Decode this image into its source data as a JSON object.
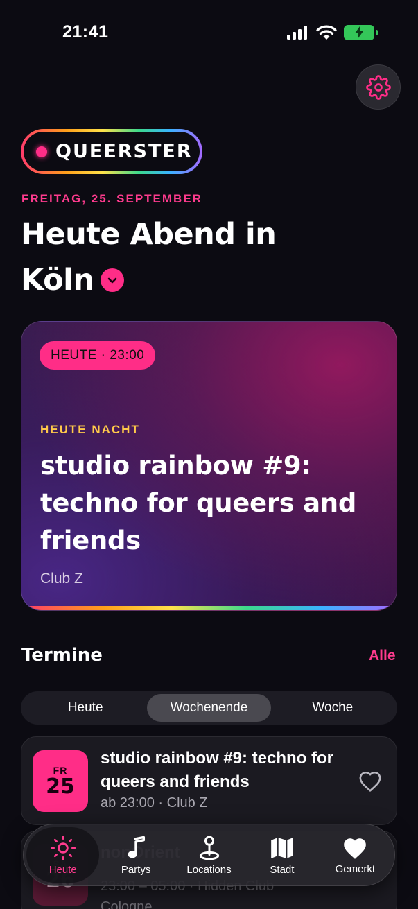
{
  "status_bar": {
    "time": "21:41"
  },
  "brand": {
    "logo_text": "QUEERSTER"
  },
  "header": {
    "date": "FREITAG, 25. SEPTEMBER",
    "headline_line1": "Heute Abend in",
    "headline_city": "Köln"
  },
  "featured": {
    "badge": "HEUTE · 23:00",
    "kicker": "HEUTE NACHT",
    "title": "studio rainbow #9: techno for queers and friends",
    "venue": "Club Z"
  },
  "termine": {
    "title": "Termine",
    "link": "Alle",
    "segments": [
      "Heute",
      "Wochenende",
      "Woche"
    ],
    "active_segment": "Wochenende"
  },
  "events": [
    {
      "dow": "FR",
      "day": "25",
      "title": "studio rainbow #9: techno for queers and friends",
      "meta": "ab 23:00 · Club Z"
    },
    {
      "dow": "SA",
      "day": "26",
      "title": "nonOrient",
      "meta": "23:00 – 05:00 · Hidden Club Cologne"
    }
  ],
  "tabs": [
    {
      "label": "Heute",
      "icon": "sun-icon",
      "active": true
    },
    {
      "label": "Partys",
      "icon": "music-note-icon",
      "active": false
    },
    {
      "label": "Locations",
      "icon": "map-pin-icon",
      "active": false
    },
    {
      "label": "Stadt",
      "icon": "map-icon",
      "active": false
    },
    {
      "label": "Gemerkt",
      "icon": "heart-icon",
      "active": false
    }
  ],
  "colors": {
    "accent": "#ff2d87",
    "kicker": "#ffc94a",
    "background": "#0c0b12"
  }
}
